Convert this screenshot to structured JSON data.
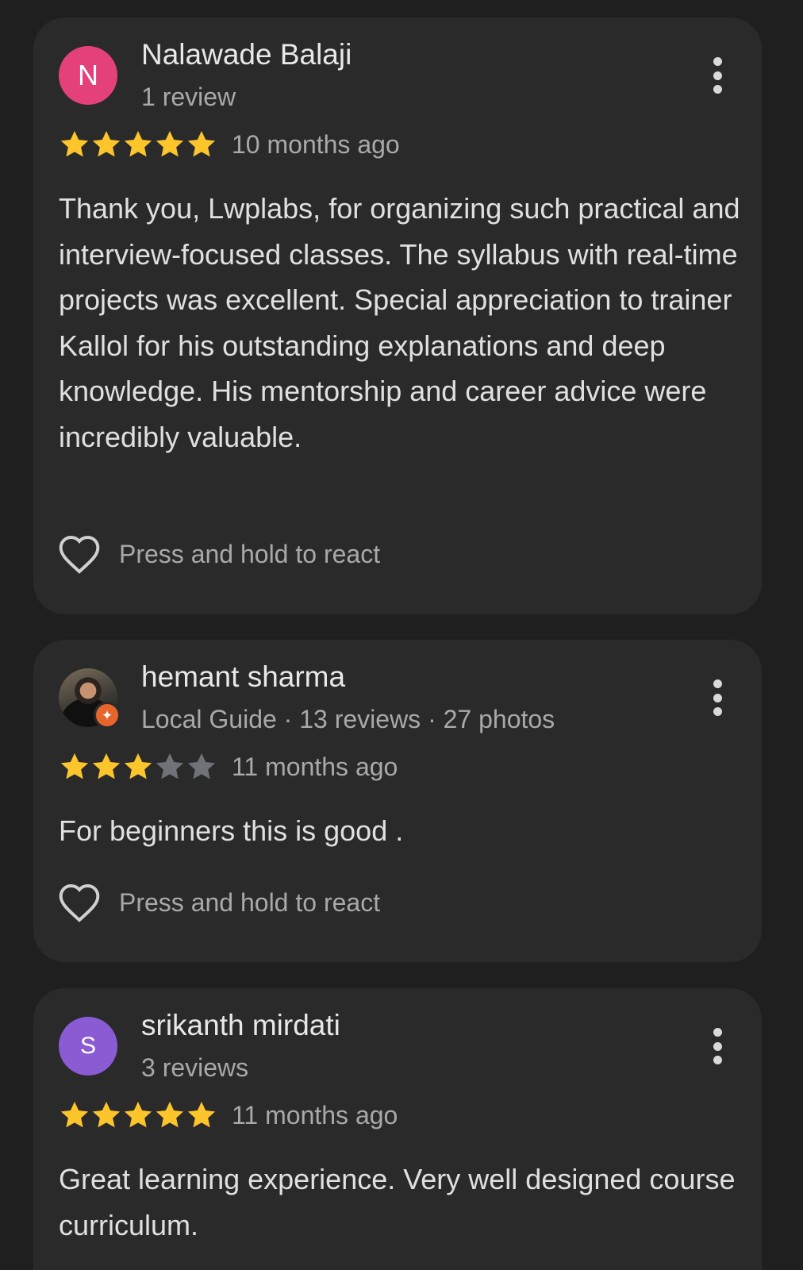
{
  "colors": {
    "background": "#1f1f1f",
    "card": "#2a2a2b",
    "star_filled": "#fbc52b",
    "star_empty": "#6f7378",
    "avatar_n": "#e4407a",
    "avatar_s": "#8a5bd3",
    "local_guide_badge": "#e6652c"
  },
  "icons": {
    "menu": "more-vert-icon",
    "react": "heart-outline-icon",
    "star": "star-icon",
    "badge": "local-guide-badge-icon"
  },
  "reviews": [
    {
      "avatar_letter": "N",
      "name": "Nalawade Balaji",
      "meta": "1 review",
      "rating": 5,
      "max_rating": 5,
      "time": "10 months ago",
      "text": "Thank you, Lwplabs, for organizing such practical and interview-focused classes. The syllabus with real-time projects was excellent. Special appreciation to trainer Kallol for his outstanding explanations and deep knowledge. His mentorship and career advice were incredibly valuable.",
      "react_label": "Press and hold to react"
    },
    {
      "avatar_letter": "",
      "name": "hemant sharma",
      "meta": "Local Guide · 13 reviews · 27 photos",
      "rating": 3,
      "max_rating": 5,
      "time": "11 months ago",
      "text": "For beginners this is good .",
      "react_label": "Press and hold to react"
    },
    {
      "avatar_letter": "S",
      "name": "srikanth mirdati",
      "meta": "3 reviews",
      "rating": 5,
      "max_rating": 5,
      "time": "11 months ago",
      "text": "Great learning experience. Very well designed course curriculum."
    }
  ]
}
